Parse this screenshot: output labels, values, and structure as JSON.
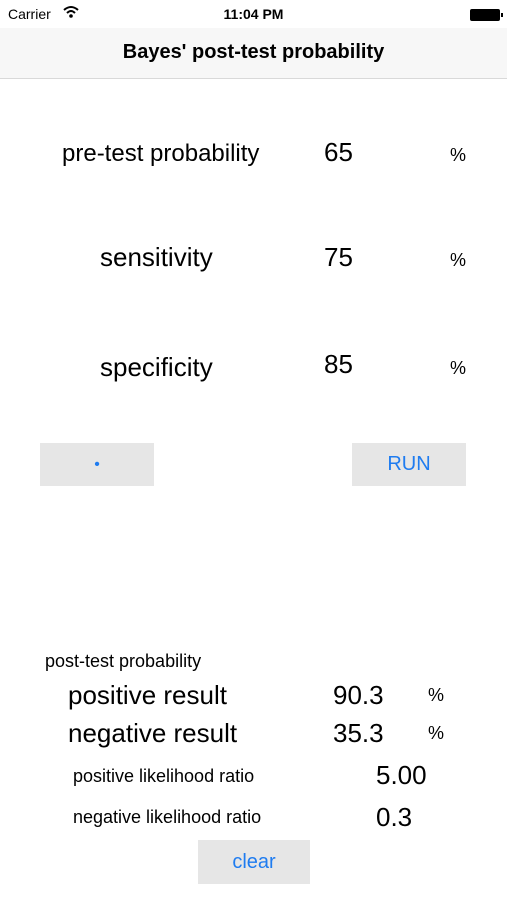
{
  "status_bar": {
    "carrier": "Carrier",
    "time": "11:04 PM"
  },
  "nav": {
    "title": "Bayes' post-test probability"
  },
  "inputs": [
    {
      "label": "pre-test probability",
      "value": "65",
      "unit": "%"
    },
    {
      "label": "sensitivity",
      "value": "75",
      "unit": "%"
    },
    {
      "label": "specificity",
      "value": "85",
      "unit": "%"
    }
  ],
  "buttons": {
    "dot": "•",
    "run": "RUN",
    "clear": "clear"
  },
  "results": {
    "heading": "post-test probability",
    "positive_label": "positive result",
    "positive_value": "90.3",
    "negative_label": "negative result",
    "negative_value": "35.3",
    "unit": "%",
    "plr_label": "positive likelihood ratio",
    "plr_value": "5.00",
    "nlr_label": "negative likelihood ratio",
    "nlr_value": "0.3"
  },
  "colors": {
    "accent": "#1f7cf0",
    "button_bg": "#e6e6e6",
    "nav_bg": "#f7f7f7"
  }
}
